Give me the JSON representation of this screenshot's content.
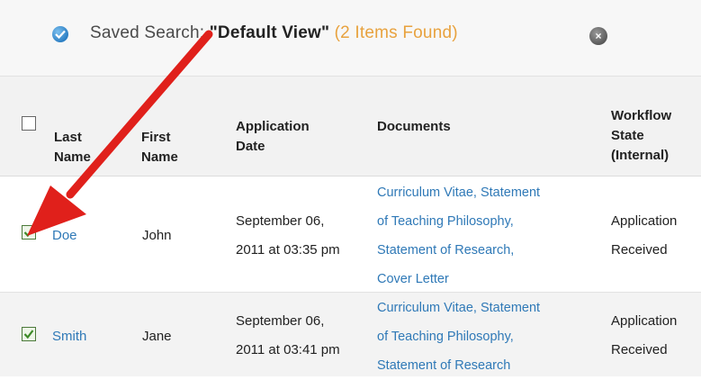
{
  "search": {
    "label": "Saved Search: ",
    "view_name": "\"Default View\"",
    "count": "(2 Items Found)"
  },
  "columns": {
    "last_name": [
      "Last",
      "Name"
    ],
    "first_name": [
      "First",
      "Name"
    ],
    "application_date": [
      "Application",
      "Date"
    ],
    "documents": "Documents",
    "workflow_state": [
      "Workflow",
      "State",
      "(Internal)"
    ]
  },
  "rows": [
    {
      "checked": true,
      "last_name": "Doe",
      "first_name": "John",
      "date_lines": [
        "September 06,",
        "2011 at 03:35 pm"
      ],
      "documents": [
        "Curriculum Vitae",
        "Statement of Teaching Philosophy",
        "Statement of Research",
        "Cover Letter"
      ],
      "doc_lines": [
        "Curriculum Vitae, Statement",
        "of Teaching Philosophy,",
        "Statement of Research,",
        "Cover Letter"
      ],
      "state_lines": [
        "Application",
        "Received"
      ]
    },
    {
      "checked": true,
      "last_name": "Smith",
      "first_name": "Jane",
      "date_lines": [
        "September 06,",
        "2011 at 03:41 pm"
      ],
      "documents": [
        "Curriculum Vitae",
        "Statement of Teaching Philosophy",
        "Statement of Research"
      ],
      "doc_lines": [
        "Curriculum Vitae, Statement",
        "of Teaching Philosophy,",
        "Statement of Research"
      ],
      "state_lines": [
        "Application",
        "Received"
      ]
    }
  ],
  "icons": {
    "saved_search": "checkmark-circle-icon",
    "clear_search": "close-circle-icon",
    "annotation": "red-arrow"
  },
  "colors": {
    "link": "#2f79b7",
    "count": "#e8a23e",
    "arrow": "#e0201b",
    "check": "#3d8a28"
  }
}
